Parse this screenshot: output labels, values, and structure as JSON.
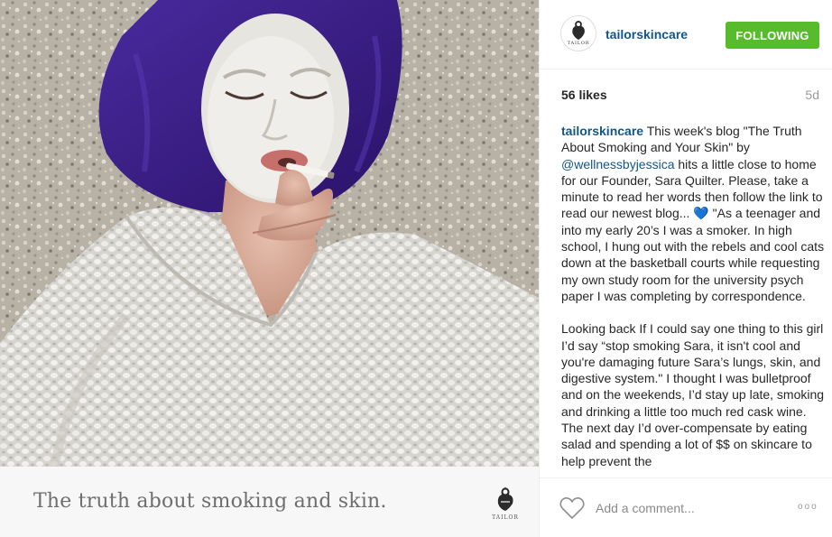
{
  "photo": {
    "alt": "Woman with white face mask and purple towel, smoking a cigarette, wearing a fluffy knit sweater"
  },
  "caption_card": {
    "text": "The truth about smoking and skin.",
    "logo_word": "TAILOR"
  },
  "header": {
    "avatar_word": "TAILOR",
    "username": "tailorskincare",
    "follow_label": "FOLLOWING"
  },
  "stats": {
    "likes": "56 likes",
    "time": "5d"
  },
  "post": {
    "author": "tailorskincare",
    "text_1": " This week's blog \"The Truth About Smoking and Your Skin\" by ",
    "mention": "@wellnessbyjessica",
    "text_2": " hits a little close to home for our Founder, Sara Quilter. Please, take a minute to read her words then follow the link to read our newest blog... ",
    "heart": "💙",
    "text_3": " \"As a teenager and into my early 20’s I was a smoker. In high school, I hung out with the rebels and cool cats down at the basketball courts while requesting my own study room for the university psych paper I was completing by correspondence.",
    "paragraph_2": "Looking back If I could say one thing to this girl I’d say “stop smoking Sara, it isn't cool and you're damaging future Sara’s lungs, skin, and digestive system.\" I thought I was bulletproof and on the weekends, I’d stay up late, smoking and drinking a little too much red cask wine. The next day I’d over-compensate by eating salad and spending a lot of $$ on skincare to help prevent the"
  },
  "footer": {
    "comment_placeholder": "Add a comment...",
    "more_label": "ooo"
  },
  "colors": {
    "username": "#125688",
    "follow_button": "#57bb2c",
    "towel": "#3d1d88",
    "caption_bg": "#f7f7f7"
  },
  "icons": {
    "like": "heart-outline-icon",
    "more": "ellipsis-icon",
    "brand": "tailor-logo-icon"
  }
}
